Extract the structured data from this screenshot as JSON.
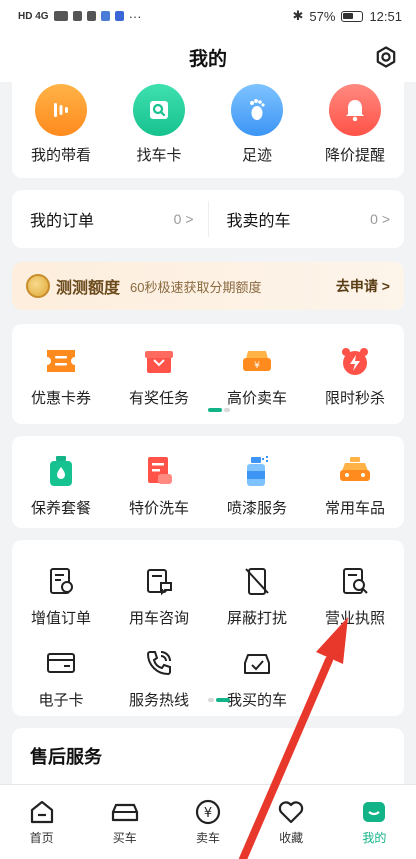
{
  "status_bar": {
    "left_indicators": "HD 4G",
    "battery": "57%",
    "time": "12:51"
  },
  "header": {
    "title": "我的"
  },
  "top_shortcuts": [
    {
      "label": "我的带看",
      "icon": "viewing-icon",
      "color": "#ff8a1e"
    },
    {
      "label": "找车卡",
      "icon": "car-card-icon",
      "color": "#16c28f"
    },
    {
      "label": "足迹",
      "icon": "footprint-icon",
      "color": "#3c95f5"
    },
    {
      "label": "降价提醒",
      "icon": "bell-icon",
      "color": "#ff5248"
    }
  ],
  "orders": [
    {
      "label": "我的订单",
      "count": "0",
      "chevron": ">"
    },
    {
      "label": "我卖的车",
      "count": "0",
      "chevron": ">"
    }
  ],
  "promo": {
    "title": "测测额度",
    "desc": "60秒极速获取分期额度",
    "action": "去申请 >"
  },
  "services_row1": [
    {
      "label": "优惠卡券",
      "icon": "coupon-icon"
    },
    {
      "label": "有奖任务",
      "icon": "gift-icon"
    },
    {
      "label": "高价卖车",
      "icon": "sell-car-icon"
    },
    {
      "label": "限时秒杀",
      "icon": "flash-sale-icon"
    }
  ],
  "services_row2": [
    {
      "label": "保养套餐",
      "icon": "oil-icon"
    },
    {
      "label": "特价洗车",
      "icon": "car-wash-icon"
    },
    {
      "label": "喷漆服务",
      "icon": "spray-icon"
    },
    {
      "label": "常用车品",
      "icon": "car-goods-icon"
    }
  ],
  "tools": [
    {
      "label": "增值订单",
      "icon": "value-order-icon"
    },
    {
      "label": "用车咨询",
      "icon": "consult-icon"
    },
    {
      "label": "屏蔽打扰",
      "icon": "block-icon"
    },
    {
      "label": "营业执照",
      "icon": "license-icon"
    },
    {
      "label": "电子卡",
      "icon": "e-card-icon"
    },
    {
      "label": "服务热线",
      "icon": "hotline-icon"
    },
    {
      "label": "我买的车",
      "icon": "bought-car-icon"
    }
  ],
  "after_sales": {
    "title": "售后服务"
  },
  "tabs": [
    {
      "label": "首页",
      "icon": "home-icon"
    },
    {
      "label": "买车",
      "icon": "buy-car-icon"
    },
    {
      "label": "卖车",
      "icon": "sell-icon"
    },
    {
      "label": "收藏",
      "icon": "heart-icon"
    },
    {
      "label": "我的",
      "icon": "profile-icon"
    }
  ],
  "colors": {
    "brand_green": "#12b386",
    "accent_orange": "#ff8a1e",
    "annotation_red": "#e8382c"
  }
}
